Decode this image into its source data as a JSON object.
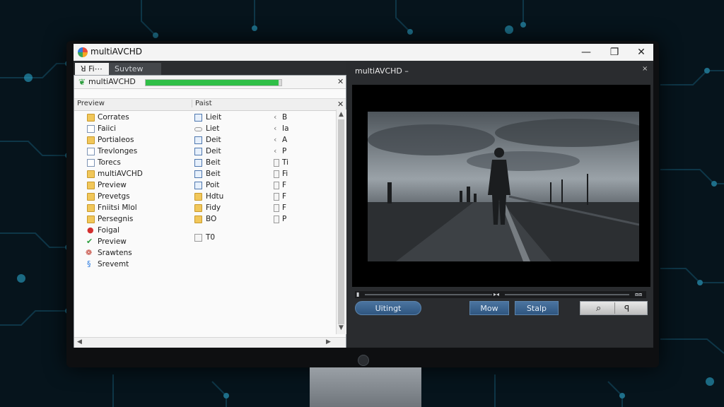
{
  "window": {
    "title": "multiAVCHD",
    "controls": {
      "minimize": "—",
      "maximize": "❐",
      "close": "✕"
    }
  },
  "left": {
    "tabs": [
      {
        "label": "ꓤ Fi⋯"
      },
      {
        "label": "Suvtew"
      }
    ],
    "path": {
      "label": "multiAVCHD",
      "progress": 0.98,
      "close": "✕"
    },
    "header": {
      "col1": "Preview",
      "col2": "Paist",
      "close": "✕"
    },
    "col1": [
      {
        "label": "Corrates",
        "icon": "folder-icon"
      },
      {
        "label": "Faiici",
        "icon": "document-icon"
      },
      {
        "label": "Portialeos",
        "icon": "folder-icon"
      },
      {
        "label": "Trevlonges",
        "icon": "document-icon"
      },
      {
        "label": "Torecs",
        "icon": "document-icon"
      },
      {
        "label": "multiAVCHD",
        "icon": "folder-icon"
      },
      {
        "label": "Preview",
        "icon": "folder-icon"
      },
      {
        "label": "Prevetgs",
        "icon": "folder-icon"
      },
      {
        "label": "Fniitsi Mlol",
        "icon": "folder-icon"
      },
      {
        "label": "Persegnis",
        "icon": "folder-icon"
      },
      {
        "label": "Foigal",
        "icon": "red-circle-icon"
      },
      {
        "label": "Preview",
        "icon": "green-check-icon"
      },
      {
        "label": "Srawtens",
        "icon": "colorful-icon"
      },
      {
        "label": "Srevemt",
        "icon": "blue-link-icon"
      }
    ],
    "col2": [
      {
        "label": "Lieit",
        "icon": "document-icon"
      },
      {
        "label": "Liet",
        "icon": "drive-icon"
      },
      {
        "label": "Deit",
        "icon": "document-icon"
      },
      {
        "label": "Deit",
        "icon": "document-icon"
      },
      {
        "label": "Beit",
        "icon": "document-icon"
      },
      {
        "label": "Beit",
        "icon": "document-icon"
      },
      {
        "label": "Poit",
        "icon": "document-icon"
      },
      {
        "label": "Hdtu",
        "icon": "folder-icon"
      },
      {
        "label": "Fidy",
        "icon": "folder-icon"
      },
      {
        "label": "BO",
        "icon": "folder-icon"
      },
      {
        "label": "T0",
        "icon": "file-icon"
      }
    ],
    "col3": [
      {
        "label": "B",
        "icon": "arrow-icon"
      },
      {
        "label": "Ia",
        "icon": "arrow-icon"
      },
      {
        "label": "A",
        "icon": "arrow-icon"
      },
      {
        "label": "P",
        "icon": "arrow-icon"
      },
      {
        "label": "Ti",
        "icon": "file-icon"
      },
      {
        "label": "Fi",
        "icon": "file-icon"
      },
      {
        "label": "F",
        "icon": "file-icon"
      },
      {
        "label": "F",
        "icon": "file-icon"
      },
      {
        "label": "F",
        "icon": "file-icon"
      },
      {
        "label": "P",
        "icon": "file-icon"
      }
    ]
  },
  "player": {
    "title": "multiAVCHD",
    "title_suffix": "–",
    "close": "×",
    "buttons": {
      "left": "Uitingt",
      "move": "Mow",
      "stop": "Stalp"
    }
  }
}
